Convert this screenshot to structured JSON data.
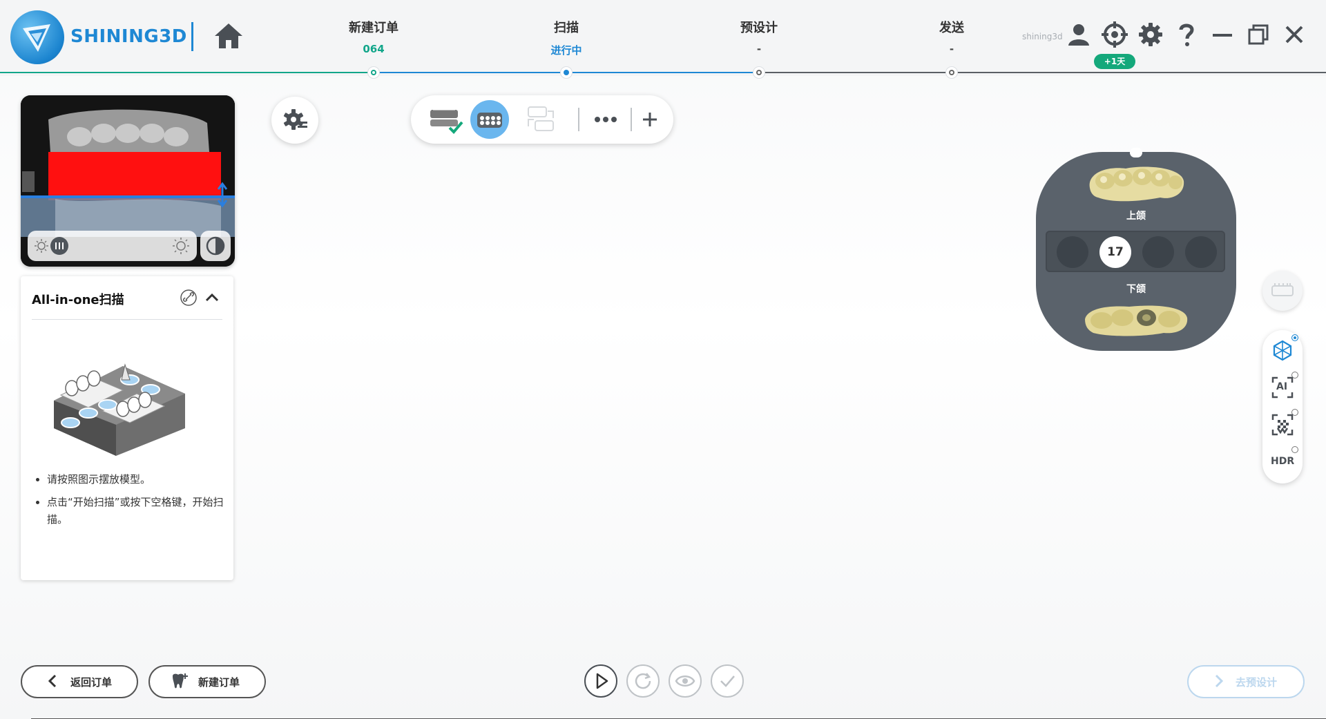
{
  "header": {
    "brand": "SHINING3D",
    "user": "shining3d",
    "trial_badge": "+1天",
    "steps": [
      {
        "title": "新建订单",
        "value": "064",
        "state": "done"
      },
      {
        "title": "扫描",
        "value": "进行中",
        "state": "active"
      },
      {
        "title": "预设计",
        "value": "-",
        "state": "todo"
      },
      {
        "title": "发送",
        "value": "-",
        "state": "todo"
      }
    ],
    "icons": [
      "home-icon",
      "user-icon",
      "target-icon",
      "gear-icon",
      "help-icon",
      "minimize-icon",
      "restore-icon",
      "close-icon"
    ],
    "colors": {
      "done": "#12a68a",
      "active": "#1e88d4",
      "todo": "#666666"
    }
  },
  "guide": {
    "title": "All-in-one扫描",
    "instructions": [
      "请按照图示摆放模型。",
      "点击“开始扫描”或按下空格键，开始扫描。"
    ]
  },
  "jaw": {
    "upper_label": "上颌",
    "lower_label": "下颌",
    "active_slot": "17"
  },
  "side": {
    "hdr_label": "HDR",
    "ai_label": "AI"
  },
  "bottom": {
    "back_label": "返回订单",
    "new_label": "新建订单",
    "next_label": "去预设计"
  }
}
